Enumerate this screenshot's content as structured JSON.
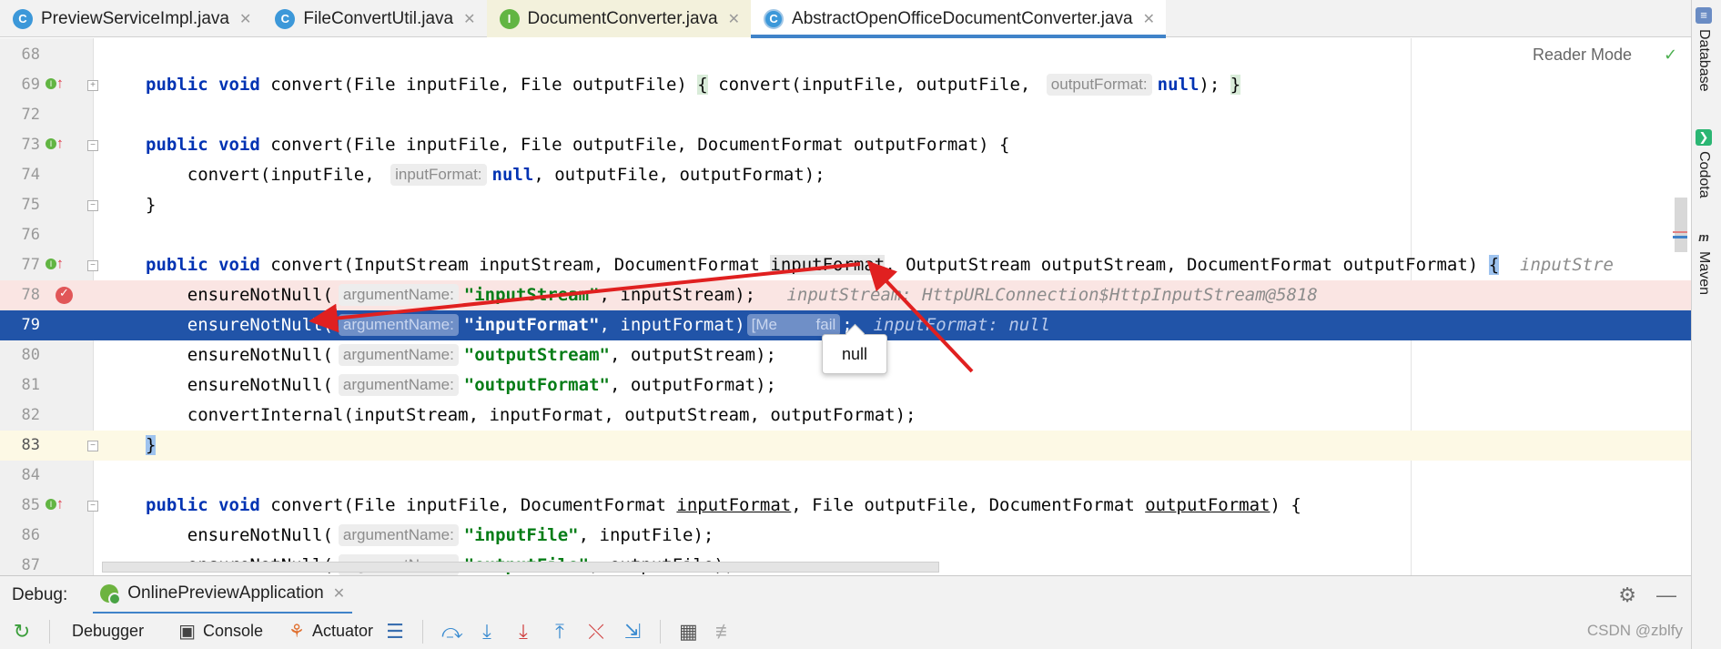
{
  "tabs": [
    {
      "label": "PreviewServiceImpl.java",
      "icon": "c"
    },
    {
      "label": "FileConvertUtil.java",
      "icon": "c"
    },
    {
      "label": "DocumentConverter.java",
      "icon": "i"
    },
    {
      "label": "AbstractOpenOfficeDocumentConverter.java",
      "icon": "c"
    }
  ],
  "right_tools": {
    "database": "Database",
    "codota": "Codota",
    "maven": "Maven"
  },
  "reader_mode": "Reader Mode",
  "hints": {
    "output_format": "outputFormat:",
    "input_format": "inputFormat:",
    "argument_name": "argumentName:"
  },
  "debug_values": {
    "line77": "inputStre",
    "line78": "inputStream: HttpURLConnection$HttpInputStream@5818",
    "line79": "inputFormat: null",
    "line79_collapsed": "[Me",
    "line79_collapsed_2": "fail"
  },
  "tooltip": "null",
  "line_numbers": [
    "68",
    "69",
    "72",
    "73",
    "74",
    "75",
    "76",
    "77",
    "78",
    "79",
    "80",
    "81",
    "82",
    "83",
    "84",
    "85",
    "86",
    "87"
  ],
  "code": {
    "kw_public": "public",
    "kw_void": "void",
    "kw_null": "null",
    "l69_a": " convert(File inputFile, File outputFile) ",
    "l69_b": "{",
    "l69_c": " convert(inputFile, outputFile, ",
    "l69_d": "); ",
    "l69_e": "}",
    "l73": " convert(File inputFile, File outputFile, DocumentFormat outputFormat) {",
    "l74_a": "    convert(inputFile, ",
    "l74_b": ", outputFile, outputFormat);",
    "l75": "}",
    "l77_a": " convert(InputStream inputStream, DocumentFormat ",
    "l77_id": "inputFormat",
    "l77_b": ", OutputStream outputStream, DocumentFormat outputFormat) ",
    "l77_c": "{",
    "ensure": "    ensureNotNull(",
    "s_inputStream": "\"inputStream\"",
    "l78_b": ", inputStream);",
    "s_inputFormat": "\"inputFormat\"",
    "l79_b": ", inputFormat)",
    "l79_c": ";",
    "s_outputStream": "\"outputStream\"",
    "l80_b": ", outputStream);",
    "s_outputFormat": "\"outputFormat\"",
    "l81_b": ", outputFormat);",
    "l82": "    convertInternal(inputStream, inputFormat, outputStream, outputFormat);",
    "l83": "}",
    "l85_a": " convert(File inputFile, DocumentFormat ",
    "l85_b": "inputFormat",
    "l85_c": ", File outputFile, DocumentFormat ",
    "l85_d": "outputFormat",
    "l85_e": ") {",
    "s_inputFile": "\"inputFile\"",
    "l86_b": ", inputFile);",
    "s_outputFile": "\"outputFile\"",
    "l87_b": ", outputFile);"
  },
  "debug_panel": {
    "label": "Debug:",
    "session": "OnlinePreviewApplication",
    "tools": {
      "debugger": "Debugger",
      "console": "Console",
      "actuator": "Actuator"
    }
  },
  "watermark": "CSDN @zblfy"
}
